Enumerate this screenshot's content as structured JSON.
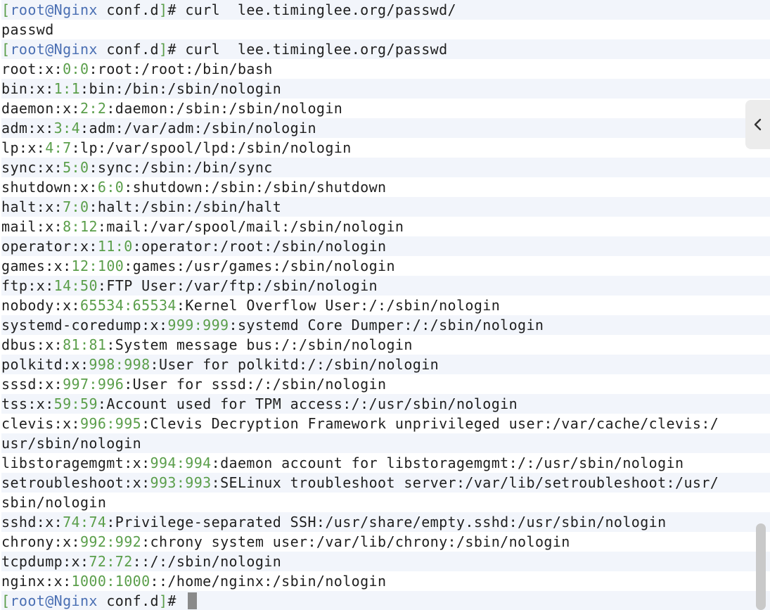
{
  "terminal": {
    "prompt": {
      "open": "[",
      "user": "root@Nginx",
      "dir": " conf.d",
      "close": "]",
      "symbol": "# "
    },
    "commands": [
      "curl  lee.timinglee.org/passwd/",
      "curl  lee.timinglee.org/passwd",
      ""
    ],
    "output_first": "passwd",
    "passwd_entries": [
      {
        "name": "root",
        "uid": "0",
        "gid": "0",
        "rest": ":root:/root:/bin/bash"
      },
      {
        "name": "bin",
        "uid": "1",
        "gid": "1",
        "rest": ":bin:/bin:/sbin/nologin"
      },
      {
        "name": "daemon",
        "uid": "2",
        "gid": "2",
        "rest": ":daemon:/sbin:/sbin/nologin"
      },
      {
        "name": "adm",
        "uid": "3",
        "gid": "4",
        "rest": ":adm:/var/adm:/sbin/nologin"
      },
      {
        "name": "lp",
        "uid": "4",
        "gid": "7",
        "rest": ":lp:/var/spool/lpd:/sbin/nologin"
      },
      {
        "name": "sync",
        "uid": "5",
        "gid": "0",
        "rest": ":sync:/sbin:/bin/sync"
      },
      {
        "name": "shutdown",
        "uid": "6",
        "gid": "0",
        "rest": ":shutdown:/sbin:/sbin/shutdown"
      },
      {
        "name": "halt",
        "uid": "7",
        "gid": "0",
        "rest": ":halt:/sbin:/sbin/halt"
      },
      {
        "name": "mail",
        "uid": "8",
        "gid": "12",
        "rest": ":mail:/var/spool/mail:/sbin/nologin"
      },
      {
        "name": "operator",
        "uid": "11",
        "gid": "0",
        "rest": ":operator:/root:/sbin/nologin"
      },
      {
        "name": "games",
        "uid": "12",
        "gid": "100",
        "rest": ":games:/usr/games:/sbin/nologin"
      },
      {
        "name": "ftp",
        "uid": "14",
        "gid": "50",
        "rest": ":FTP User:/var/ftp:/sbin/nologin"
      },
      {
        "name": "nobody",
        "uid": "65534",
        "gid": "65534",
        "rest": ":Kernel Overflow User:/:/sbin/nologin"
      },
      {
        "name": "systemd-coredump",
        "uid": "999",
        "gid": "999",
        "rest": ":systemd Core Dumper:/:/sbin/nologin"
      },
      {
        "name": "dbus",
        "uid": "81",
        "gid": "81",
        "rest": ":System message bus:/:/sbin/nologin"
      },
      {
        "name": "polkitd",
        "uid": "998",
        "gid": "998",
        "rest": ":User for polkitd:/:/sbin/nologin"
      },
      {
        "name": "sssd",
        "uid": "997",
        "gid": "996",
        "rest": ":User for sssd:/:/sbin/nologin"
      },
      {
        "name": "tss",
        "uid": "59",
        "gid": "59",
        "rest": ":Account used for TPM access:/:/usr/sbin/nologin"
      },
      {
        "name": "clevis",
        "uid": "996",
        "gid": "995",
        "rest": ":Clevis Decryption Framework unprivileged user:/var/cache/clevis:/",
        "cont": "usr/sbin/nologin"
      },
      {
        "name": "libstoragemgmt",
        "uid": "994",
        "gid": "994",
        "rest": ":daemon account for libstoragemgmt:/:/usr/sbin/nologin"
      },
      {
        "name": "setroubleshoot",
        "uid": "993",
        "gid": "993",
        "rest": ":SELinux troubleshoot server:/var/lib/setroubleshoot:/usr/",
        "cont": "sbin/nologin"
      },
      {
        "name": "sshd",
        "uid": "74",
        "gid": "74",
        "rest": ":Privilege-separated SSH:/usr/share/empty.sshd:/usr/sbin/nologin"
      },
      {
        "name": "chrony",
        "uid": "992",
        "gid": "992",
        "rest": ":chrony system user:/var/lib/chrony:/sbin/nologin"
      },
      {
        "name": "tcpdump",
        "uid": "72",
        "gid": "72",
        "rest": "::/:/sbin/nologin"
      },
      {
        "name": "nginx",
        "uid": "1000",
        "gid": "1000",
        "rest": "::/home/nginx:/sbin/nologin"
      }
    ],
    "colors": {
      "bracket": "#5a9e4a",
      "prompt_user": "#4a6fb3",
      "numbers": "#5a9e4a",
      "text": "#1f1f1f",
      "alt_row": "#f2f5fb"
    }
  },
  "side_panel_toggle": {
    "icon": "chevron-left-icon"
  }
}
